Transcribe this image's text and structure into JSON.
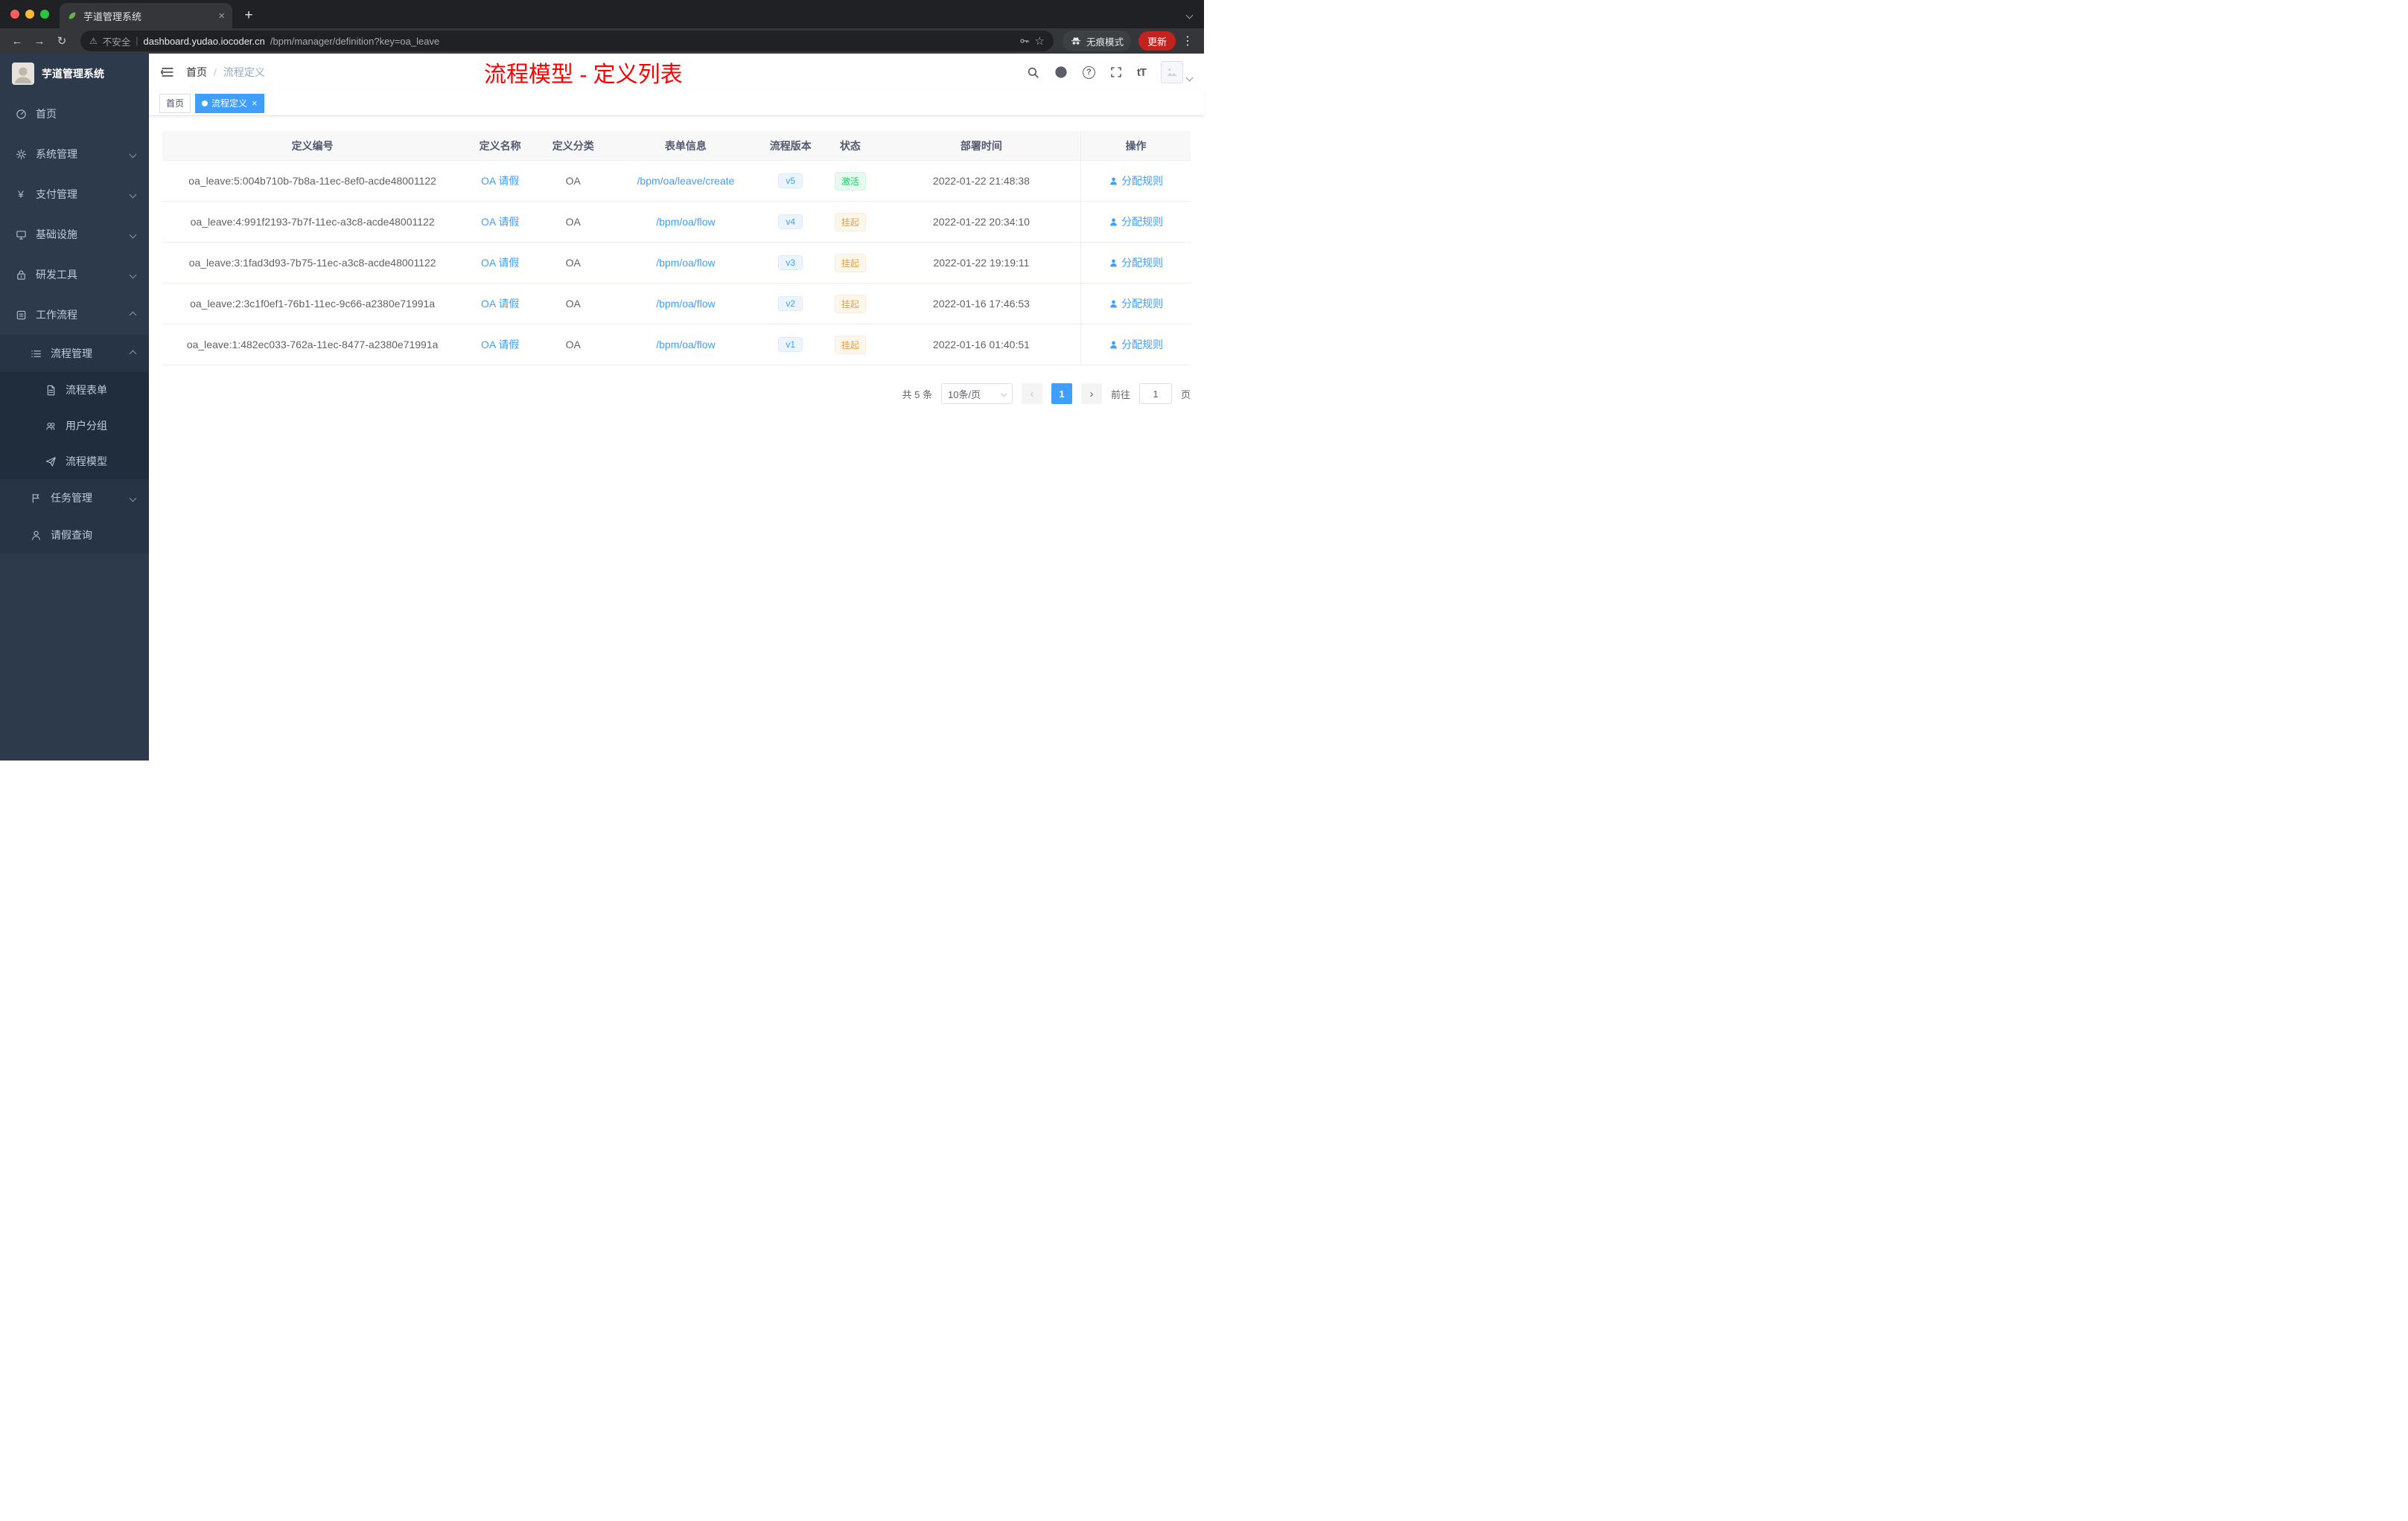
{
  "browser": {
    "tab_title": "芋道管理系统",
    "security_label": "不安全",
    "url_host": "dashboard.yudao.iocoder.cn",
    "url_path": "/bpm/manager/definition?key=oa_leave",
    "incognito_label": "无痕模式",
    "update_label": "更新"
  },
  "icons": {
    "back": "←",
    "forward": "→",
    "reload": "↻",
    "warning": "⚠",
    "divider": "|",
    "star": "☆",
    "dots": "⋮",
    "close": "×",
    "plus": "+",
    "yen": "¥",
    "question": "?",
    "font_size": "tT",
    "breadcrumb_sep": "/",
    "prev": "‹",
    "next": "›"
  },
  "sidebar": {
    "logo_title": "芋道管理系统",
    "home": "首页",
    "system": "系统管理",
    "payment": "支付管理",
    "infra": "基础设施",
    "devtools": "研发工具",
    "workflow": "工作流程",
    "process_mgmt": "流程管理",
    "process_form": "流程表单",
    "user_group": "用户分组",
    "process_model": "流程模型",
    "task_mgmt": "任务管理",
    "leave_query": "请假查询"
  },
  "header": {
    "breadcrumb_home": "首页",
    "breadcrumb_current": "流程定义",
    "annotation": "流程模型 - 定义列表"
  },
  "tags": {
    "home": "首页",
    "active": "流程定义"
  },
  "table": {
    "columns": {
      "id": "定义编号",
      "name": "定义名称",
      "category": "定义分类",
      "form": "表单信息",
      "version": "流程版本",
      "status": "状态",
      "deploy_time": "部署时间",
      "actions": "操作"
    },
    "rows": [
      {
        "id": "oa_leave:5:004b710b-7b8a-11ec-8ef0-acde48001122",
        "name": "OA 请假",
        "category": "OA",
        "form": "/bpm/oa/leave/create",
        "version": "v5",
        "status": "激活",
        "deploy_time": "2022-01-22 21:48:38",
        "action": "分配规则"
      },
      {
        "id": "oa_leave:4:991f2193-7b7f-11ec-a3c8-acde48001122",
        "name": "OA 请假",
        "category": "OA",
        "form": "/bpm/oa/flow",
        "version": "v4",
        "status": "挂起",
        "deploy_time": "2022-01-22 20:34:10",
        "action": "分配规则"
      },
      {
        "id": "oa_leave:3:1fad3d93-7b75-11ec-a3c8-acde48001122",
        "name": "OA 请假",
        "category": "OA",
        "form": "/bpm/oa/flow",
        "version": "v3",
        "status": "挂起",
        "deploy_time": "2022-01-22 19:19:11",
        "action": "分配规则"
      },
      {
        "id": "oa_leave:2:3c1f0ef1-76b1-11ec-9c66-a2380e71991a",
        "name": "OA 请假",
        "category": "OA",
        "form": "/bpm/oa/flow",
        "version": "v2",
        "status": "挂起",
        "deploy_time": "2022-01-16 17:46:53",
        "action": "分配规则"
      },
      {
        "id": "oa_leave:1:482ec033-762a-11ec-8477-a2380e71991a",
        "name": "OA 请假",
        "category": "OA",
        "form": "/bpm/oa/flow",
        "version": "v1",
        "status": "挂起",
        "deploy_time": "2022-01-16 01:40:51",
        "action": "分配规则"
      }
    ]
  },
  "pagination": {
    "total": "共 5 条",
    "page_size": "10条/页",
    "page": "1",
    "goto": "前往",
    "goto_value": "1",
    "unit": "页"
  }
}
